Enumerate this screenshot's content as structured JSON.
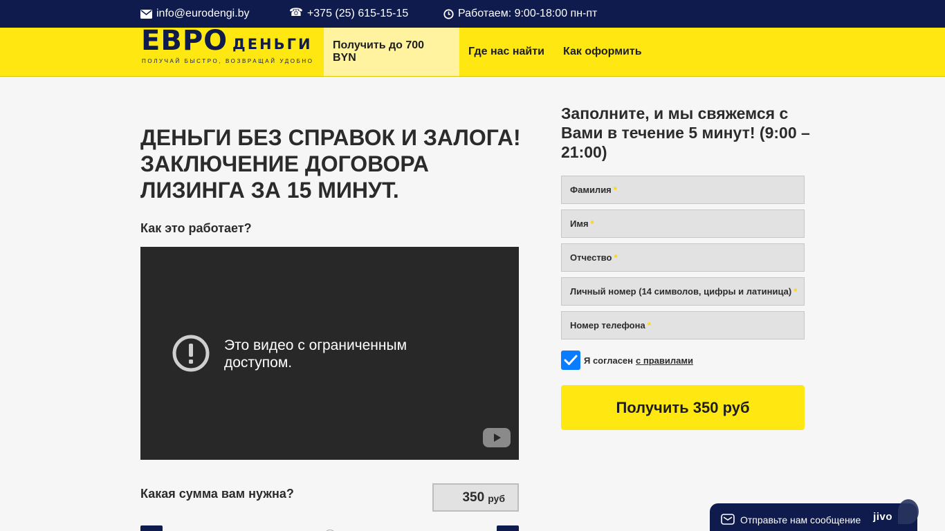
{
  "topbar": {
    "email": "info@eurodengi.by",
    "phone": "+375 (25) 615-15-15",
    "hours": "Работаем: 9:00-18:00 пн-пт",
    "icons": [
      "envelope-icon",
      "phone-icon",
      "clock-icon"
    ]
  },
  "logo": {
    "word1": "ЕВРО",
    "word2": "ДЕНЬГИ",
    "tagline": "ПОЛУЧАЙ БЫСТРО, ВОЗВРАЩАЙ УДОБНО"
  },
  "nav": {
    "items": [
      {
        "label": "Получить до 700 BYN",
        "active": true
      },
      {
        "label": "Где нас найти",
        "active": false
      },
      {
        "label": "Как оформить",
        "active": false
      }
    ]
  },
  "main": {
    "hero": "ДЕНЬГИ БЕЗ СПРАВОК И ЗАЛОГА! ЗАКЛЮЧЕНИЕ ДОГОВОРА ЛИЗИНГА ЗА 15 МИНУТ.",
    "how_label": "Как это работает?",
    "video_message": "Это видео с ограниченным доступом.",
    "sum_label": "Какая сумма вам нужна?",
    "sum_value": "350",
    "sum_unit": "руб",
    "slider_fraction": 0.5
  },
  "form": {
    "title": "Заполните, и мы свяжемся с Вами в течение 5 минут! (9:00 – 21:00)",
    "fields": [
      {
        "label": "Фамилия"
      },
      {
        "label": "Имя"
      },
      {
        "label": "Отчество"
      },
      {
        "label": "Личный номер (14 символов, цифры и латиница)"
      },
      {
        "label": "Номер телефона"
      }
    ],
    "required_mark": "*",
    "agree_text": "Я согласен",
    "agree_link": "с правилами",
    "agree_checked": true,
    "submit_label": "Получить 350 руб"
  },
  "jivo": {
    "message": "Отправьте нам сообщение",
    "brand": "jivo"
  },
  "colors": {
    "navy": "#0f1a4d",
    "yellow": "#ffe811",
    "checkbox": "#0a7cff"
  }
}
